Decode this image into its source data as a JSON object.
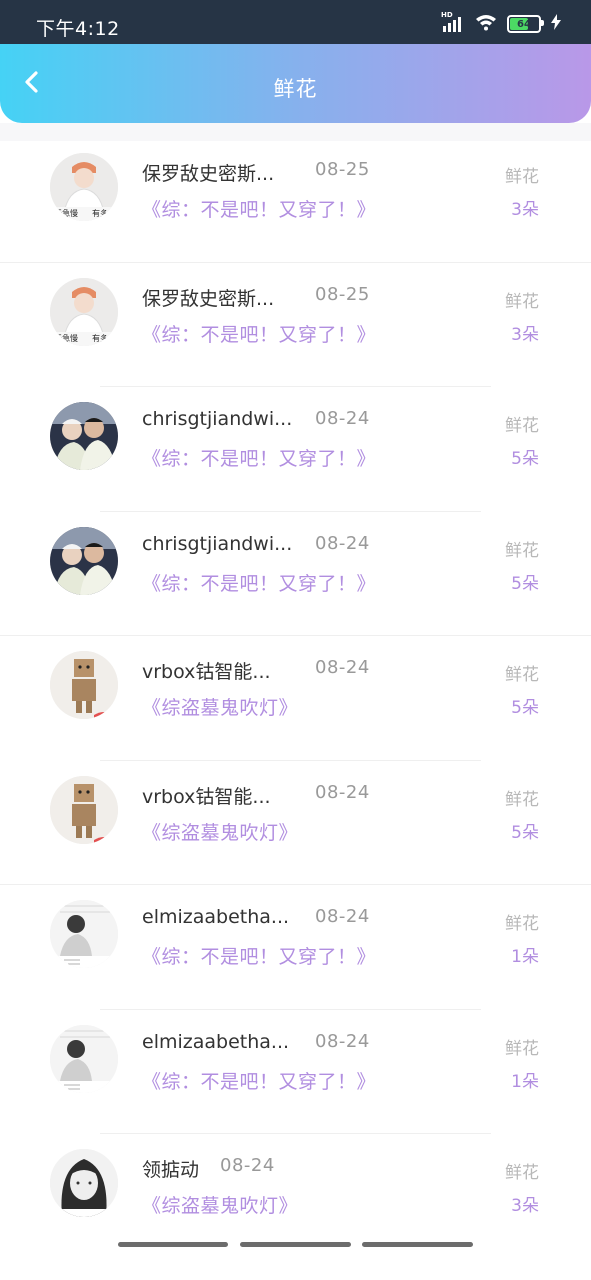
{
  "status_bar": {
    "time": "下午4:12",
    "network_label": "HD",
    "battery_level": "64",
    "battery_color": "#4cd964"
  },
  "header": {
    "title": "鲜花",
    "back_icon": "chevron-left-icon",
    "gradient": [
      "#45d2f5",
      "#b998e8"
    ]
  },
  "accent_color": "#b18ee0",
  "items": [
    {
      "name": "保罗敌史密斯...",
      "date": "08-25",
      "book": "《综：不是吧！又穿了！》",
      "label": "鲜花",
      "count": "3朵",
      "avatar_text": [
        "无急慢",
        "有多"
      ]
    },
    {
      "name": "保罗敌史密斯...",
      "date": "08-25",
      "book": "《综：不是吧！又穿了！》",
      "label": "鲜花",
      "count": "3朵",
      "avatar_text": [
        "无急慢",
        "有多"
      ]
    },
    {
      "name": "chrisgtjiandwi...",
      "date": "08-24",
      "book": "《综：不是吧！又穿了！》",
      "label": "鲜花",
      "count": "5朵"
    },
    {
      "name": "chrisgtjiandwi...",
      "date": "08-24",
      "book": "《综：不是吧！又穿了！》",
      "label": "鲜花",
      "count": "5朵"
    },
    {
      "name": "vrbox钴智能...",
      "date": "08-24",
      "book": "《综盗墓鬼吹灯》",
      "label": "鲜花",
      "count": "5朵"
    },
    {
      "name": "vrbox钴智能...",
      "date": "08-24",
      "book": "《综盗墓鬼吹灯》",
      "label": "鲜花",
      "count": "5朵"
    },
    {
      "name": "elmizaabetha...",
      "date": "08-24",
      "book": "《综：不是吧！又穿了！》",
      "label": "鲜花",
      "count": "1朵"
    },
    {
      "name": "elmizaabetha...",
      "date": "08-24",
      "book": "《综：不是吧！又穿了！》",
      "label": "鲜花",
      "count": "1朵"
    },
    {
      "name": "领掂动",
      "date": "08-24",
      "book": "《综盗墓鬼吹灯》",
      "label": "鲜花",
      "count": "3朵"
    }
  ]
}
